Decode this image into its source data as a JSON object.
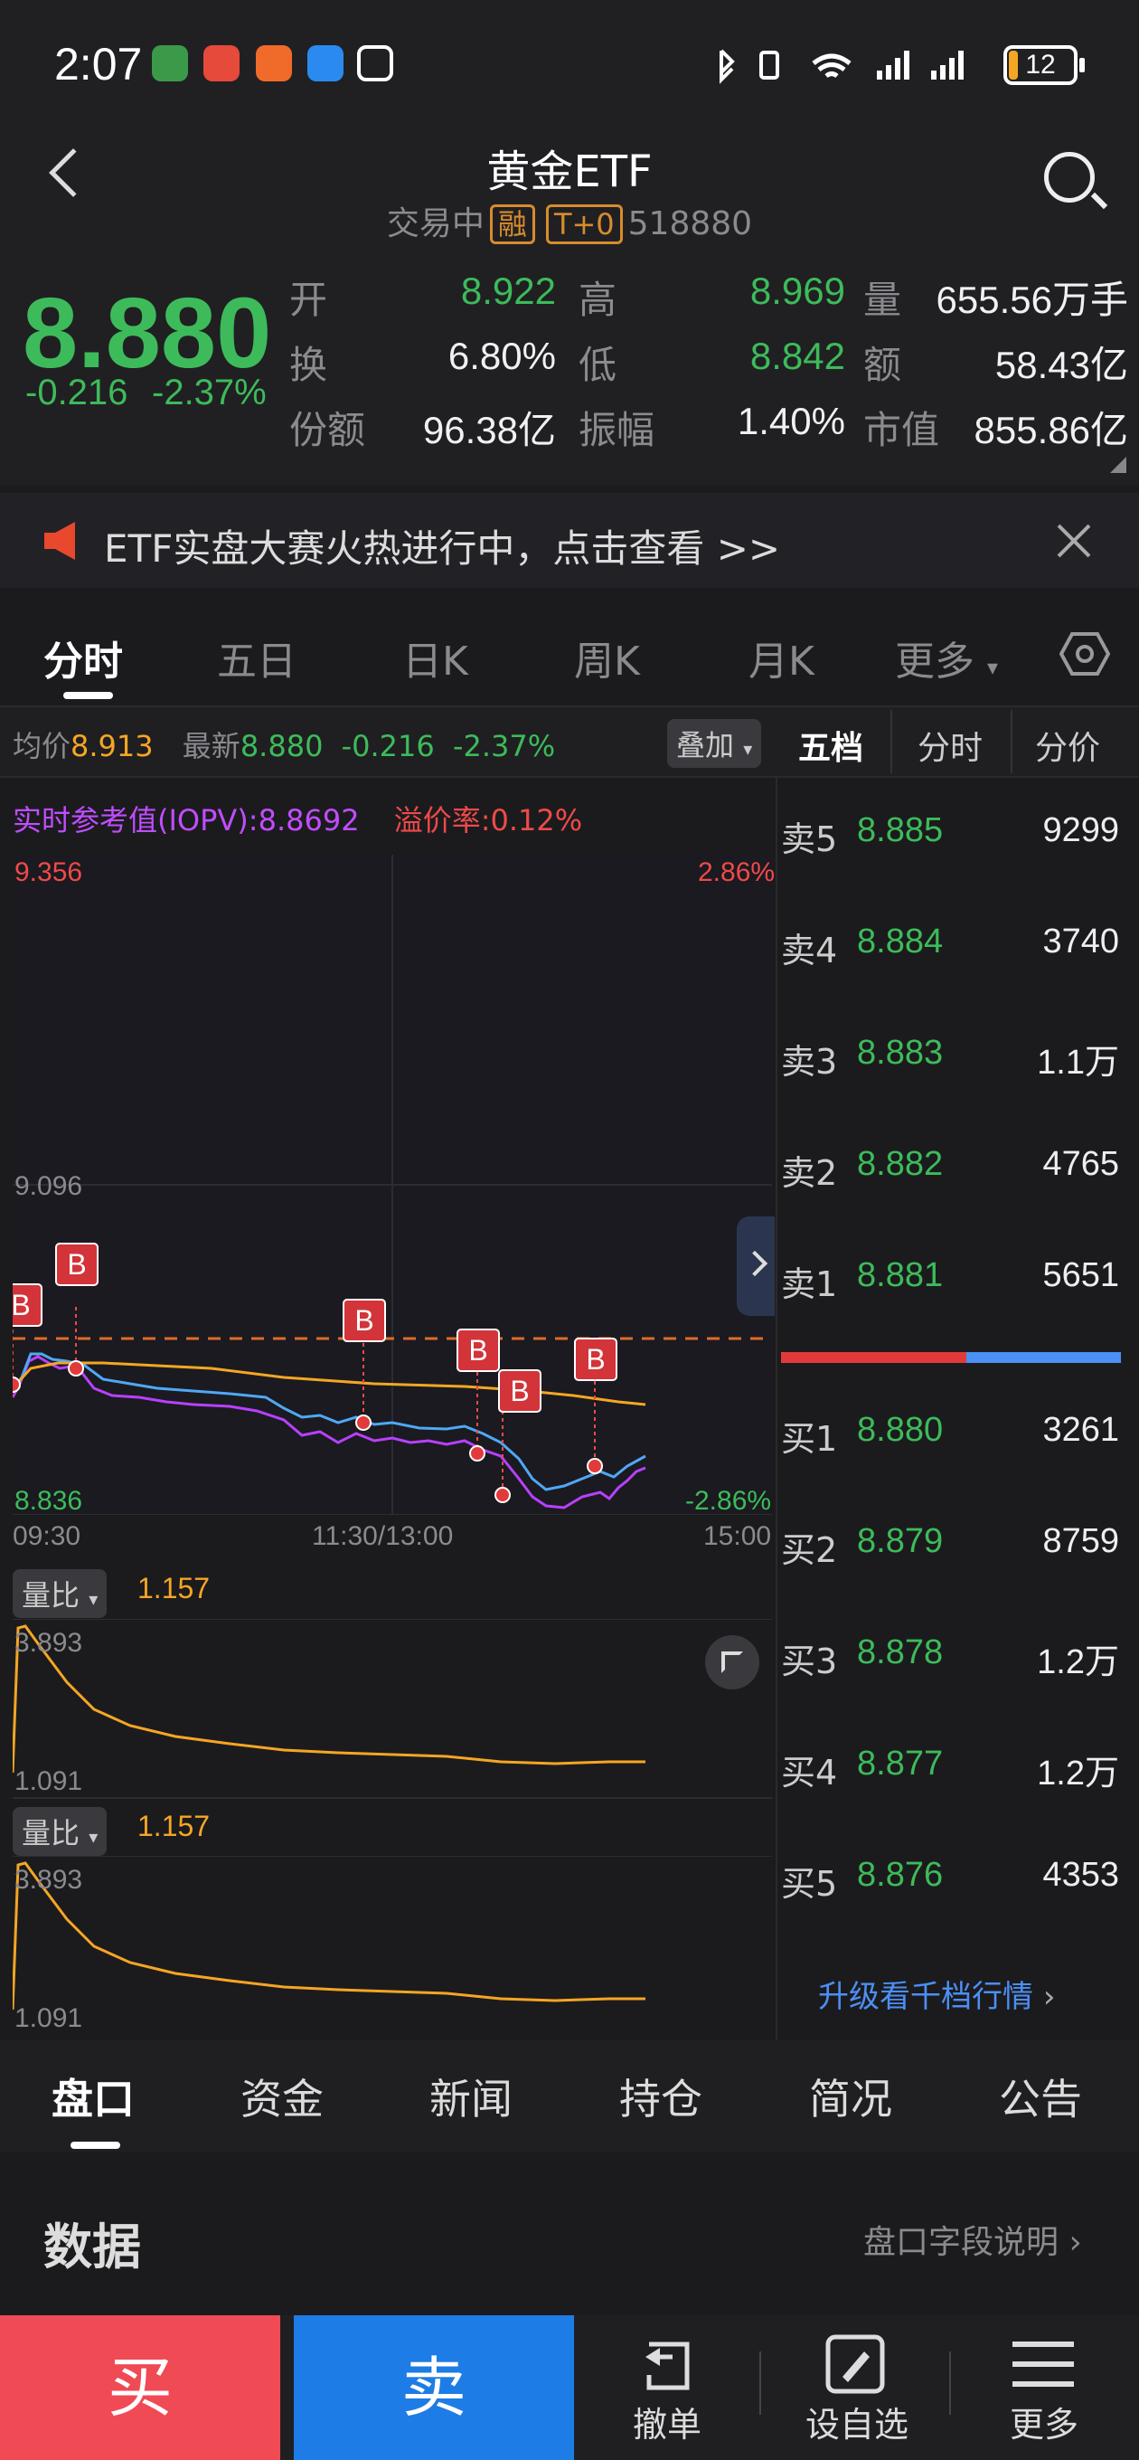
{
  "status": {
    "time": "2:07",
    "battery": "12"
  },
  "header": {
    "title": "黄金ETF",
    "trading": "交易中",
    "tag_margin": "融",
    "tag_t0": "T+0",
    "code": "518880"
  },
  "quote": {
    "price": "8.880",
    "change": "-0.216",
    "change_pct": "-2.37%",
    "labels": {
      "open": "开",
      "high": "高",
      "volume": "量",
      "turnover": "换",
      "low": "低",
      "amount": "额",
      "shares": "份额",
      "amplitude": "振幅",
      "mktcap": "市值"
    },
    "values": {
      "open": "8.922",
      "high": "8.969",
      "volume": "655.56万手",
      "turnover": "6.80%",
      "low": "8.842",
      "amount": "58.43亿",
      "shares": "96.38亿",
      "amplitude": "1.40%",
      "mktcap": "855.86亿"
    }
  },
  "banner": {
    "text": "ETF实盘大赛火热进行中，点击查看 >>"
  },
  "tabs": [
    "分时",
    "五日",
    "日K",
    "周K",
    "月K",
    "更多"
  ],
  "chart_info": {
    "avg_label": "均价",
    "avg_value": "8.913",
    "latest_label": "最新",
    "latest_value": "8.880",
    "latest_chg": "-0.216",
    "latest_pct": "-2.37%",
    "overlay": "叠加",
    "iopv_label": "实时参考值(IOPV):",
    "iopv_value": "8.8692",
    "premium_label": "溢价率:",
    "premium_value": "0.12%"
  },
  "chart_axes": {
    "top_price": "9.356",
    "top_pct": "2.86%",
    "mid_price": "9.096",
    "bottom_price": "8.836",
    "bottom_pct": "-2.86%",
    "t_start": "09:30",
    "t_mid": "11:30/13:00",
    "t_end": "15:00"
  },
  "chart_data": {
    "type": "line",
    "x_range": [
      "09:30",
      "15:00"
    ],
    "ylim": [
      8.836,
      9.356
    ],
    "series": [],
    "markers": [
      "B",
      "B",
      "B",
      "B",
      "B",
      "B"
    ]
  },
  "volume_panels": [
    {
      "label": "量比",
      "value": "1.157",
      "top": "3.893",
      "bottom": "1.091"
    },
    {
      "label": "量比",
      "value": "1.157",
      "top": "3.893",
      "bottom": "1.091"
    }
  ],
  "book": {
    "tabs": [
      "五档",
      "分时",
      "分价"
    ],
    "asks": [
      {
        "label": "卖5",
        "price": "8.885",
        "vol": "9299"
      },
      {
        "label": "卖4",
        "price": "8.884",
        "vol": "3740"
      },
      {
        "label": "卖3",
        "price": "8.883",
        "vol": "1.1万"
      },
      {
        "label": "卖2",
        "price": "8.882",
        "vol": "4765"
      },
      {
        "label": "卖1",
        "price": "8.881",
        "vol": "5651"
      }
    ],
    "bids": [
      {
        "label": "买1",
        "price": "8.880",
        "vol": "3261"
      },
      {
        "label": "买2",
        "price": "8.879",
        "vol": "8759"
      },
      {
        "label": "买3",
        "price": "8.878",
        "vol": "1.2万"
      },
      {
        "label": "买4",
        "price": "8.877",
        "vol": "1.2万"
      },
      {
        "label": "买5",
        "price": "8.876",
        "vol": "4353"
      }
    ],
    "upgrade": "升级看千档行情"
  },
  "bottom_tabs": [
    "盘口",
    "资金",
    "新闻",
    "持仓",
    "简况",
    "公告"
  ],
  "section": {
    "title": "数据",
    "help": "盘口字段说明"
  },
  "actions": {
    "buy": "买",
    "sell": "卖",
    "cancel": "撤单",
    "watch": "设自选",
    "more": "更多"
  }
}
